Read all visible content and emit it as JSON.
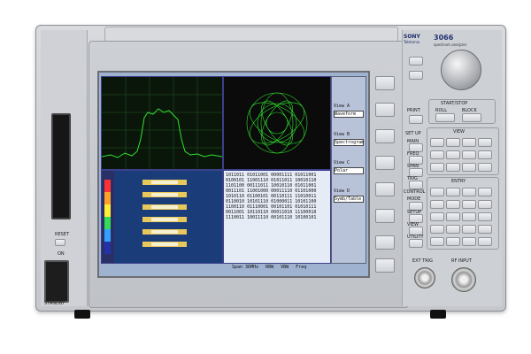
{
  "brand": {
    "sony": "SONY",
    "tek": "Tektronix"
  },
  "model": {
    "number": "3066",
    "subtitle": "spectrum analyzer"
  },
  "left_panel": {
    "reset_label": "RESET",
    "on_label": "ON",
    "standby_label": "STANDBY"
  },
  "screen": {
    "view_a_label": "View A",
    "view_a_value": "Waveform",
    "view_b_label": "View B",
    "view_b_value": "Spectrogram",
    "view_c_label": "View C",
    "view_c_value": "Polar",
    "view_d_label": "View D",
    "view_d_value": "Symb/Table",
    "bottom_bar": [
      "Span 36MHz",
      "RBW",
      "VBW",
      "Freq"
    ],
    "table_rows": [
      "1011011 01011001 00001111 01011001",
      "0100101 11001110 01011011 10010110",
      "1101100 00111011 10010110 01011001",
      "0011101 11001000 00011110 01101000",
      "1010110 01100101 00110111 11010011",
      "0110010 10101110 01000011 10101100",
      "1100110 01110001 00101101 01010111",
      "0011001 10110110 00011010 11100010",
      "1110011 10011110 00101110 10100101"
    ]
  },
  "right_panel": {
    "start_stop_label": "START/STOP",
    "roll_label": "ROLL",
    "block_label": "BLOCK",
    "setup_label": "SET UP",
    "view_label": "VIEW",
    "entry_label": "ENTRY",
    "control_label": "CONTROL",
    "print_label": "PRINT",
    "ext_trig_label": "EXT TRIG",
    "rf_input_label": "RF INPUT",
    "setup_keys": [
      "MAIN",
      "FREQ",
      "SPAN",
      "TRIG",
      "MODE"
    ],
    "control_keys": [
      "MODE",
      "SETUP",
      "VIEW",
      "UTILITY"
    ]
  },
  "colors": {
    "trace": "#2fe12f",
    "screen_frame": "#6b6e75",
    "panel_body": "#d0d2d7"
  }
}
